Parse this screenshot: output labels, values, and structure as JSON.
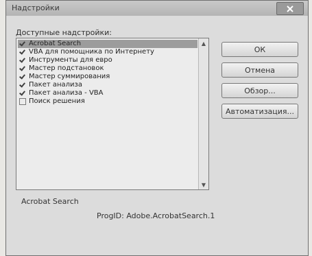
{
  "window": {
    "title": "Надстройки"
  },
  "addins": {
    "label": "Доступные надстройки:",
    "items": [
      {
        "label": "Acrobat Search",
        "checked": true,
        "selected": true
      },
      {
        "label": "VBA для помощника по Интернету",
        "checked": true,
        "selected": false
      },
      {
        "label": "Инструменты для евро",
        "checked": true,
        "selected": false
      },
      {
        "label": "Мастер подстановок",
        "checked": true,
        "selected": false
      },
      {
        "label": "Мастер суммирования",
        "checked": true,
        "selected": false
      },
      {
        "label": "Пакет анализа",
        "checked": true,
        "selected": false
      },
      {
        "label": "Пакет анализа - VBA",
        "checked": true,
        "selected": false
      },
      {
        "label": "Поиск решения",
        "checked": false,
        "selected": false
      }
    ]
  },
  "buttons": {
    "ok": "ОК",
    "cancel": "Отмена",
    "browse": "Обзор...",
    "automation": "Автоматизация..."
  },
  "details": {
    "selected_name": "Acrobat Search",
    "progid": "ProgID: Adobe.AcrobatSearch.1"
  }
}
